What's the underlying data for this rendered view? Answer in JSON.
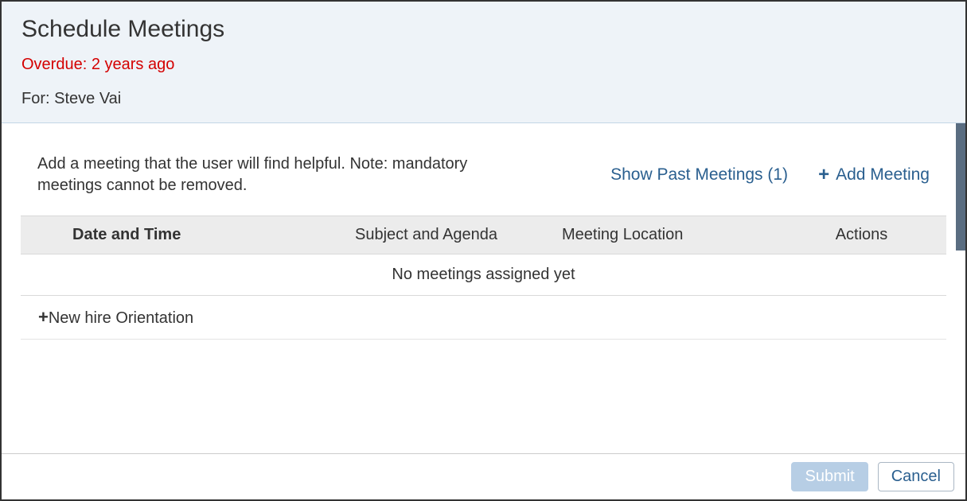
{
  "header": {
    "title": "Schedule Meetings",
    "overdue": "Overdue: 2 years ago",
    "for_line": "For: Steve Vai"
  },
  "main": {
    "instructions": "Add a meeting that the user will find helpful. Note: mandatory meetings cannot be removed.",
    "show_past_link": "Show Past Meetings (1)",
    "add_meeting_link": "Add Meeting"
  },
  "table": {
    "columns": {
      "date": "Date and Time",
      "subject": "Subject and Agenda",
      "location": "Meeting Location",
      "actions": "Actions"
    },
    "empty_message": "No meetings assigned yet",
    "recommended_item": "New hire Orientation"
  },
  "footer": {
    "submit": "Submit",
    "cancel": "Cancel"
  }
}
